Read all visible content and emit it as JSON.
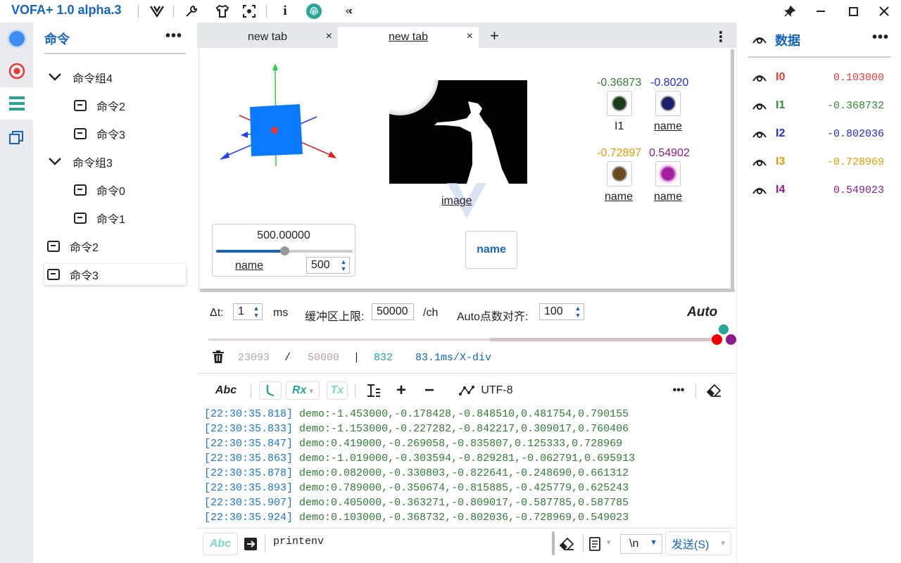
{
  "app": {
    "title": "VOFA+ 1.0 alpha.3"
  },
  "titlebar": {
    "icons": [
      "vofa-logo-icon",
      "wrench-icon",
      "tshirt-icon",
      "scan-icon",
      "info-icon",
      "fingerprint-icon",
      "collapse-icon"
    ]
  },
  "sidebar": {
    "title": "命令",
    "more": "•••",
    "tree": [
      {
        "label": "命令组4",
        "type": "group"
      },
      {
        "label": "命令2",
        "type": "command"
      },
      {
        "label": "命令3",
        "type": "command"
      },
      {
        "label": "命令组3",
        "type": "group"
      },
      {
        "label": "命令0",
        "type": "command"
      },
      {
        "label": "命令1",
        "type": "command"
      },
      {
        "label": "命令2",
        "type": "command"
      },
      {
        "label": "命令3",
        "type": "command",
        "selected": true
      }
    ]
  },
  "tabs": [
    {
      "label": "new tab",
      "close": "×",
      "active": false
    },
    {
      "label": "new tab",
      "close": "×",
      "active": true
    }
  ],
  "tabbar": {
    "add": "+",
    "more": "⋮"
  },
  "widgets": {
    "image_label": "image",
    "lamps": [
      {
        "value": "-0.36873",
        "name": "I1",
        "value_color": "#2e7d32",
        "dot_color": "#1b3d1b"
      },
      {
        "value": "-0.8020",
        "name": "name",
        "value_color": "#1e2bd6",
        "dot_color": "#1a1f6e"
      },
      {
        "value": "-0.72897",
        "name": "name",
        "value_color": "#e69a00",
        "dot_color": "#6b4a1c"
      },
      {
        "value": "0.54902",
        "name": "name",
        "value_color": "#8e1a8e",
        "dot_color": "#a020a0"
      }
    ],
    "slider": {
      "value_text": "500.00000",
      "name": "name",
      "spin_value": "500",
      "fraction": 0.5
    },
    "button": {
      "label": "name"
    }
  },
  "controls": {
    "dt_label": "Δt:",
    "dt_value": "1",
    "dt_unit": "ms",
    "buffer_label": "缓冲区上限:",
    "buffer_value": "50000",
    "buffer_unit": "/ch",
    "auto_align_label": "Auto点数对齐:",
    "auto_align_value": "100",
    "auto_label": "Auto"
  },
  "stats": {
    "count": "23093",
    "sep": "/",
    "limit": "50000",
    "bar": "|",
    "points": "832",
    "rate": "83.1ms/X-div"
  },
  "toolbar2": {
    "abc": "Abc",
    "rx": "Rx",
    "tx": "Tx",
    "plus": "+",
    "minus": "−",
    "encoding": "UTF-8",
    "more": "•••"
  },
  "log": [
    {
      "ts": "[22:30:35.818]",
      "msg": "demo:-1.453000,-0.178428,-0.848510,0.481754,0.790155"
    },
    {
      "ts": "[22:30:35.833]",
      "msg": "demo:-1.153000,-0.227282,-0.842217,0.309017,0.760406"
    },
    {
      "ts": "[22:30:35.847]",
      "msg": "demo:0.419000,-0.269058,-0.835807,0.125333,0.728969"
    },
    {
      "ts": "[22:30:35.863]",
      "msg": "demo:-1.019000,-0.303594,-0.829281,-0.062791,0.695913"
    },
    {
      "ts": "[22:30:35.878]",
      "msg": "demo:0.082000,-0.330803,-0.822641,-0.248690,0.661312"
    },
    {
      "ts": "[22:30:35.893]",
      "msg": "demo:0.789000,-0.350674,-0.815885,-0.425779,0.625243"
    },
    {
      "ts": "[22:30:35.907]",
      "msg": "demo:0.405000,-0.363271,-0.809017,-0.587785,0.587785"
    },
    {
      "ts": "[22:30:35.924]",
      "msg": "demo:0.103000,-0.368732,-0.802036,-0.728969,0.549023"
    }
  ],
  "input": {
    "abc": "Abc",
    "value": "printenv",
    "line_ending": "\\n",
    "send_label": "发送(S)"
  },
  "data_panel": {
    "title": "数据",
    "more": "•••",
    "rows": [
      {
        "name": "I0",
        "value": "0.103000",
        "color": "#e53935"
      },
      {
        "name": "I1",
        "value": "-0.368732",
        "color": "#2e8b2e"
      },
      {
        "name": "I2",
        "value": "-0.802036",
        "color": "#1e2bd6"
      },
      {
        "name": "I3",
        "value": "-0.728969",
        "color": "#e69a00"
      },
      {
        "name": "I4",
        "value": "0.549023",
        "color": "#8e1a8e"
      }
    ]
  },
  "colors": {
    "accent": "#1565c0",
    "teal": "#26a69a"
  }
}
